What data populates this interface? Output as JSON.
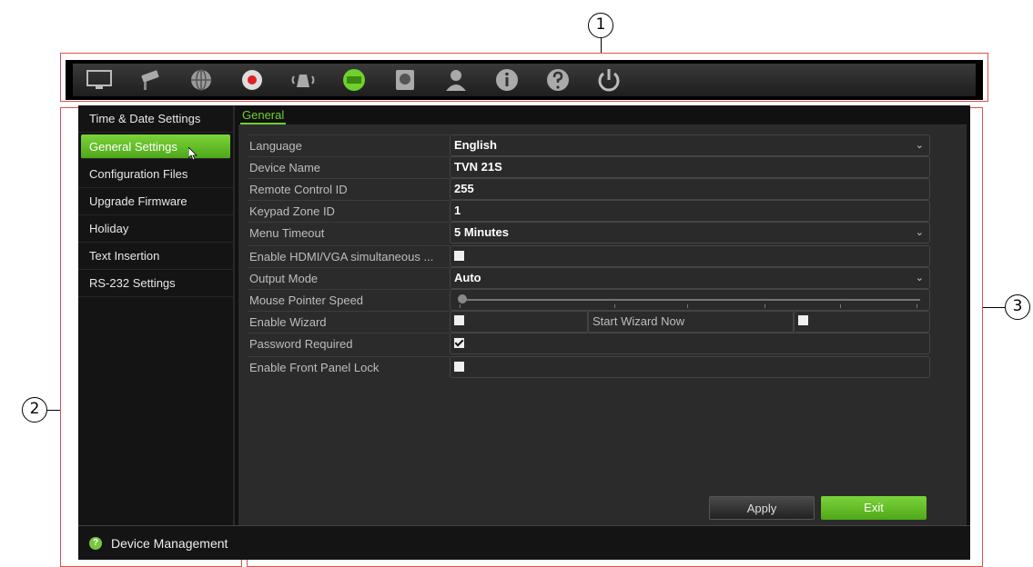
{
  "callouts": [
    "1",
    "2",
    "3"
  ],
  "toolbar": {
    "icons": [
      "monitor-icon",
      "camera-icon",
      "network-icon",
      "record-icon",
      "alarm-icon",
      "device-icon",
      "storage-icon",
      "user-icon",
      "info-icon",
      "help-icon",
      "power-icon"
    ],
    "accent": "#6fd02e"
  },
  "sidebar": {
    "items": [
      {
        "label": "Time & Date Settings"
      },
      {
        "label": "General Settings"
      },
      {
        "label": "Configuration Files"
      },
      {
        "label": "Upgrade Firmware"
      },
      {
        "label": "Holiday"
      },
      {
        "label": "Text Insertion"
      },
      {
        "label": "RS-232 Settings"
      }
    ],
    "active_index": 1
  },
  "footer": {
    "label": "Device Management"
  },
  "tab": {
    "label": "General"
  },
  "form": {
    "language": {
      "label": "Language",
      "value": "English"
    },
    "device_name": {
      "label": "Device Name",
      "value": "TVN 21S"
    },
    "remote_id": {
      "label": "Remote Control ID",
      "value": "255"
    },
    "keypad_zone": {
      "label": "Keypad Zone ID",
      "value": "1"
    },
    "menu_timeout": {
      "label": "Menu Timeout",
      "value": "5 Minutes"
    },
    "hdmi_vga": {
      "label": "Enable HDMI/VGA simultaneous ...",
      "checked": false
    },
    "output_mode": {
      "label": "Output Mode",
      "value": "Auto"
    },
    "mouse_speed": {
      "label": "Mouse Pointer Speed",
      "level": 0
    },
    "wizard": {
      "label": "Enable Wizard",
      "checked": false,
      "start_label": "Start Wizard Now",
      "start_checked": false
    },
    "password": {
      "label": "Password Required",
      "checked": true
    },
    "front_panel": {
      "label": "Enable Front Panel Lock",
      "checked": false
    }
  },
  "buttons": {
    "apply": "Apply",
    "exit": "Exit"
  }
}
